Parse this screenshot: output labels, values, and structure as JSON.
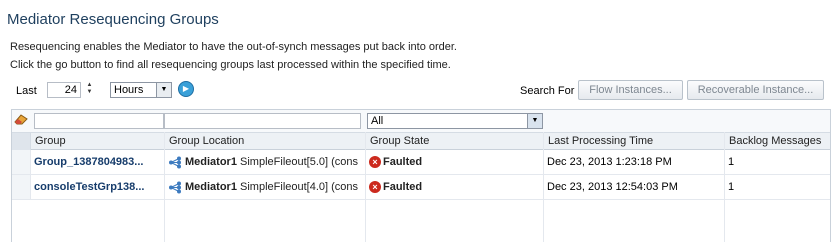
{
  "page": {
    "title": "Mediator Resequencing Groups",
    "description_line1": "Resequencing enables the Mediator to have the out-of-synch messages put back into order.",
    "description_line2": "Click the go button to find all resequencing groups last processed within the specified time."
  },
  "filter": {
    "last_label": "Last",
    "last_value": "24",
    "unit_selected": "Hours",
    "search_for_label": "Search For",
    "flow_instances_button": "Flow Instances...",
    "recoverable_instance_button": "Recoverable Instance..."
  },
  "table": {
    "state_filter_selected": "All",
    "columns": [
      "Group",
      "Group Location",
      "Group State",
      "Last Processing Time",
      "Backlog Messages"
    ],
    "rows": [
      {
        "group": "Group_1387804983...",
        "location_name": "Mediator1",
        "location_detail": "SimpleFileout[5.0] (cons",
        "state": "Faulted",
        "last_processing_time": "Dec 23, 2013 1:23:18 PM",
        "backlog": "1"
      },
      {
        "group": "consoleTestGrp138...",
        "location_name": "Mediator1",
        "location_detail": "SimpleFileout[4.0] (cons",
        "state": "Faulted",
        "last_processing_time": "Dec 23, 2013 12:54:03 PM",
        "backlog": "1"
      }
    ]
  },
  "icons": {
    "spinner": "spinner-icon",
    "go": "go-arrow-icon",
    "clear_filter": "eraser-icon",
    "mediator": "mediator-component-icon",
    "fault": "error-x-icon"
  },
  "colors": {
    "title": "#1e3f5e",
    "group_link": "#163c6b",
    "fault_red": "#cc2a1e",
    "go_blue": "#3aa0d8"
  }
}
